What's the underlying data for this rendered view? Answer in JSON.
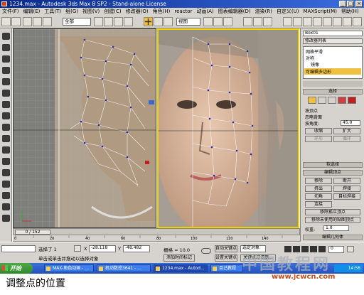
{
  "window": {
    "title": "1234.max - Autodesk 3ds Max 8 SP2 - Stand-alone License",
    "controls": [
      "_",
      "□",
      "×"
    ]
  },
  "menu": [
    "文件(F)",
    "编辑(E)",
    "工具(T)",
    "组(G)",
    "视图(V)",
    "创建(C)",
    "修改器(O)",
    "角色(H)",
    "reactor",
    "动画(A)",
    "图表编辑器(D)",
    "渲染(R)",
    "自定义(U)",
    "MAXScript(M)",
    "帮助(H)"
  ],
  "toolbar": {
    "selection_filter": "全部",
    "reference_coord": "视图",
    "active_icon": "move-icon"
  },
  "viewports": {
    "left_label": "",
    "right_label": ""
  },
  "command_panel": {
    "object_name": "Box01",
    "modifier_list": "修改器列表",
    "stack": [
      "网格平滑",
      "对称",
      "镜像",
      "可编辑多边形"
    ],
    "selection_title": "选择",
    "by_vertex": "按顶点",
    "ignore_backfacing": "忽略背面",
    "by_angle": "按角度:",
    "angle_value": "45.0",
    "shrink": "收缩",
    "grow": "扩大",
    "ring": "环形",
    "loop": "循环",
    "soft_selection": "软选择",
    "edit_vertices": "编辑顶点",
    "remove": "移除",
    "break": "断开",
    "extrude": "挤出",
    "weld": "焊接",
    "chamfer": "切角",
    "target_weld": "目标焊接",
    "connect": "连接",
    "remove_isolated": "移除孤立顶点",
    "remove_unused_map": "移除未使用的贴图顶点",
    "weight_label": "权重:",
    "weight_value": "1.0",
    "edit_geometry": "编辑几何体"
  },
  "timeline": {
    "frame_display": "0 / 152",
    "ruler_ticks": [
      "0",
      "10",
      "20",
      "30",
      "40",
      "50",
      "60",
      "70",
      "80",
      "90",
      "100",
      "110",
      "120",
      "130",
      "140",
      "150"
    ]
  },
  "status": {
    "selected": "选择了 1",
    "prompt": "单击或单击并拖动以选择对象",
    "add_time_tag": "添加时间标记",
    "x_label": "X",
    "x_value": "-28.118",
    "y_label": "Y",
    "y_value": "-48.482",
    "grid": "栅格 = 10.0",
    "auto_key": "自动关键点",
    "selected_object": "选定对象",
    "set_key": "设置关键点",
    "key_filters": "关键点过滤器...",
    "frame_field": "0"
  },
  "taskbar": {
    "start": "开始",
    "tasks": [
      "MAX-角色动画 - ...",
      "机动数控3641 - ...",
      "1234.max - Autod...",
      "目己教程"
    ],
    "clock": "14:56"
  },
  "caption": "调整点的位置",
  "watermark": {
    "text_cn": "中国教程网",
    "url": "www.jcwcn.com"
  },
  "colors": {
    "title_bar": "#0a2a8a",
    "viewport_active_border": "#f0d000",
    "selected_modifier": "#f0c040",
    "taskbar": "#2452be",
    "start_button": "#2e8a2a"
  }
}
